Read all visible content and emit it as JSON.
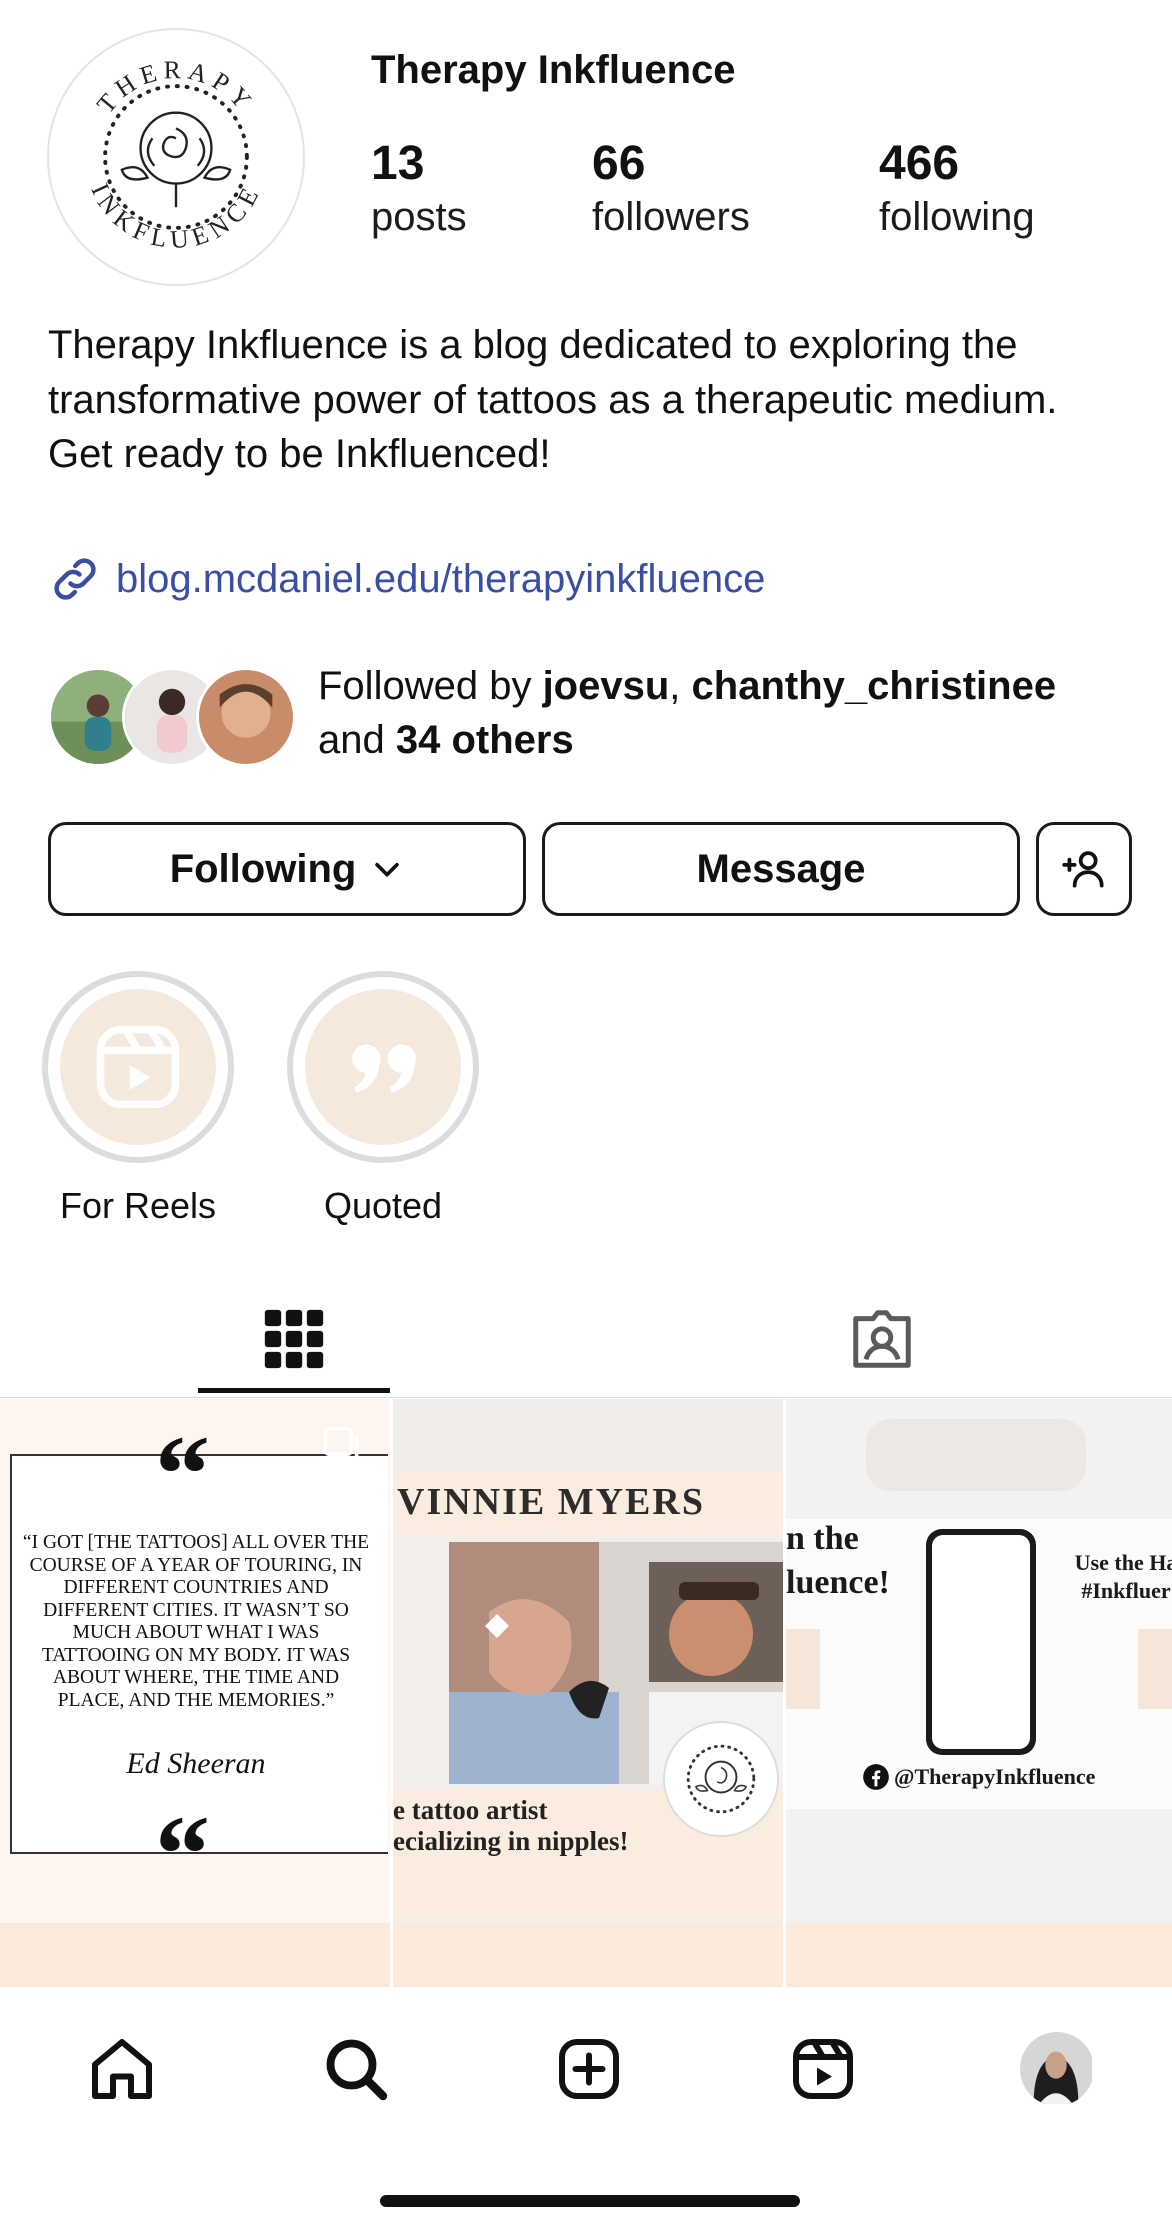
{
  "profile": {
    "name": "Therapy Inkfluence",
    "logo_text": "THERAPY INKFLUENCE",
    "stats": [
      {
        "value": "13",
        "label": "posts"
      },
      {
        "value": "66",
        "label": "followers"
      },
      {
        "value": "466",
        "label": "following"
      }
    ],
    "bio_lines": [
      "Therapy Inkfluence is a blog dedicated to exploring the transformative power of tattoos as a therapeutic medium.",
      "Get ready to be Inkfluenced!"
    ],
    "link": "blog.mcdaniel.edu/therapyinkfluence"
  },
  "followed_by": {
    "prefix": "Followed by ",
    "user1": "joevsu",
    "separator": ", ",
    "user2": "chanthy_christinee",
    "and": "and ",
    "others": "34 others"
  },
  "actions": {
    "following_label": "Following",
    "message_label": "Message",
    "add_user_icon": "add-user-icon"
  },
  "highlights": [
    {
      "label": "For Reels",
      "icon": "reels-icon"
    },
    {
      "label": "Quoted",
      "icon": "quote-icon"
    }
  ],
  "tabs": [
    {
      "name": "grid",
      "icon": "grid-icon",
      "active": true
    },
    {
      "name": "tagged",
      "icon": "tagged-icon",
      "active": false
    }
  ],
  "posts": [
    {
      "quote": "“I got [the tattoos] all over the course of a year of touring, in different countries and different cities. It wasn’t so much about what I was tattooing on my body. It was about where, the time and place, and the memories.”",
      "author": "Ed Sheeran"
    },
    {
      "title": "VINNIE MYERS",
      "caption_line1": "e tattoo artist",
      "caption_line2": "ecializing in nipples!"
    },
    {
      "headline_line1": "n the",
      "headline_line2": "luence!",
      "side_line1": "Use the Ha",
      "side_line2": "#Inkfluer",
      "handle": "@TherapyInkfluence"
    }
  ],
  "colors": {
    "link": "#3a4ea3",
    "highlight_fill": "#f5e8dc",
    "accent_peach": "#fbe9dc",
    "text": "#111111"
  },
  "nav": [
    "home-icon",
    "search-icon",
    "create-icon",
    "reels-icon",
    "profile-avatar"
  ]
}
